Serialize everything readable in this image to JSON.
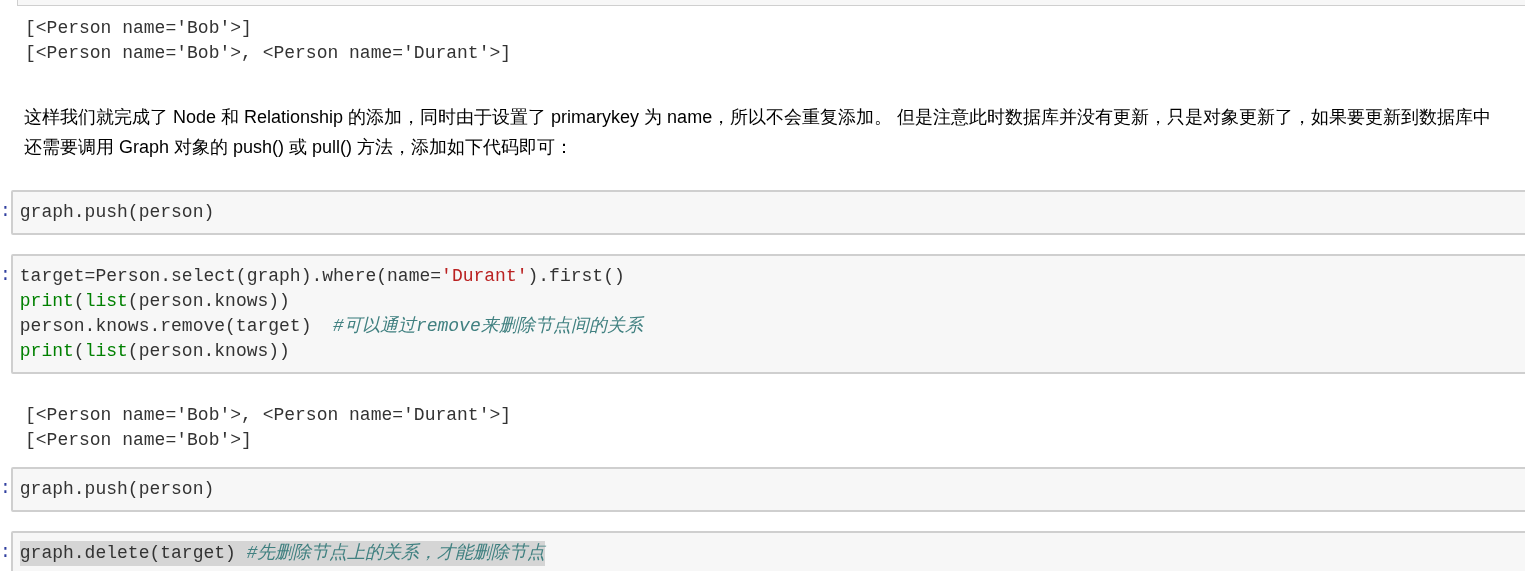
{
  "cells": [
    {
      "kind": "cell_edge"
    },
    {
      "kind": "output",
      "lines": [
        "[<Person name='Bob'>]",
        "[<Person name='Bob'>, <Person name='Durant'>]"
      ]
    },
    {
      "kind": "markdown",
      "text": "这样我们就完成了 Node 和 Relationship 的添加，同时由于设置了 primarykey 为 name，所以不会重复添加。 但是注意此时数据库并没有更新，只是对象更新了，如果要更新到数据库中还需要调用 Graph 对象的 push() 或 pull() 方法，添加如下代码即可："
    },
    {
      "kind": "code",
      "prompt": ":",
      "highlighted": false,
      "lines": [
        [
          {
            "kind": "plain",
            "text": "graph.push(person)"
          }
        ]
      ]
    },
    {
      "kind": "code",
      "prompt": ":",
      "highlighted": false,
      "lines": [
        [
          {
            "kind": "plain",
            "text": "target=Person.select(graph).where(name="
          },
          {
            "kind": "string",
            "text": "'Durant'"
          },
          {
            "kind": "plain",
            "text": ").first()"
          }
        ],
        [
          {
            "kind": "builtin",
            "text": "print"
          },
          {
            "kind": "plain",
            "text": "("
          },
          {
            "kind": "builtin",
            "text": "list"
          },
          {
            "kind": "plain",
            "text": "(person.knows))"
          }
        ],
        [
          {
            "kind": "plain",
            "text": "person.knows.remove(target)  "
          },
          {
            "kind": "comment",
            "text": "#可以通过remove来删除节点间的关系"
          }
        ],
        [
          {
            "kind": "builtin",
            "text": "print"
          },
          {
            "kind": "plain",
            "text": "("
          },
          {
            "kind": "builtin",
            "text": "list"
          },
          {
            "kind": "plain",
            "text": "(person.knows))"
          }
        ]
      ]
    },
    {
      "kind": "output",
      "lines": [
        "[<Person name='Bob'>, <Person name='Durant'>]",
        "[<Person name='Bob'>]"
      ]
    },
    {
      "kind": "code",
      "prompt": ":",
      "highlighted": false,
      "lines": [
        [
          {
            "kind": "plain",
            "text": "graph.push(person)"
          }
        ]
      ]
    },
    {
      "kind": "code",
      "prompt": ":",
      "highlighted": true,
      "lines": [
        [
          {
            "kind": "plain",
            "text": "graph.delete(target) "
          },
          {
            "kind": "comment",
            "text": "#先删除节点上的关系，才能删除节点"
          }
        ]
      ]
    }
  ]
}
